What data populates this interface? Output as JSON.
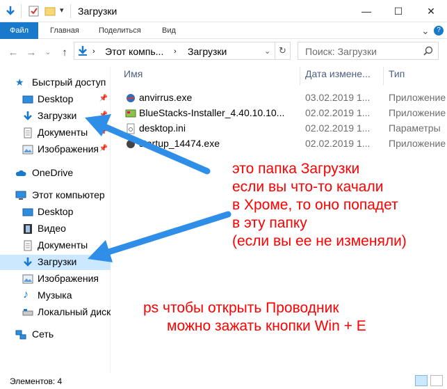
{
  "window": {
    "title": "Загрузки",
    "minimize": "—",
    "maximize": "☐",
    "close": "✕"
  },
  "ribbon": {
    "tabs": [
      "Файл",
      "Главная",
      "Поделиться",
      "Вид"
    ],
    "expand": "⌄",
    "help": "?"
  },
  "address": {
    "segments": [
      "Этот компь...",
      "Загрузки"
    ],
    "search_placeholder": "Поиск: Загрузки"
  },
  "sidebar": {
    "quick_access": "Быстрый доступ",
    "quick_items": [
      "Desktop",
      "Загрузки",
      "Документы",
      "Изображения"
    ],
    "onedrive": "OneDrive",
    "this_pc": "Этот компьютер",
    "pc_items": [
      "Desktop",
      "Видео",
      "Документы",
      "Загрузки",
      "Изображения",
      "Музыка",
      "Локальный диск"
    ],
    "network": "Сеть"
  },
  "columns": {
    "name": "Имя",
    "date": "Дата измене...",
    "type": "Тип"
  },
  "files": [
    {
      "name": "anvirrus.exe",
      "date": "03.02.2019 1...",
      "type": "Приложение"
    },
    {
      "name": "BlueStacks-Installer_4.40.10.10...",
      "date": "02.02.2019 1...",
      "type": "Приложение"
    },
    {
      "name": "desktop.ini",
      "date": "02.02.2019 1...",
      "type": "Параметры"
    },
    {
      "name": "startup_14474.exe",
      "date": "02.02.2019 1...",
      "type": "Приложение"
    }
  ],
  "status": {
    "count": "Элементов: 4"
  },
  "annotations": {
    "line1": "это папка Загрузки",
    "line2": "если вы что-то качали",
    "line3": "в Хроме, то оно попадет",
    "line4": "в эту папку",
    "line5": "(если вы ее не изменяли)",
    "tip1": "ps чтобы открыть Проводник",
    "tip2": "можно зажать кнопки Win + E"
  },
  "colors": {
    "accent": "#1979ca",
    "annotation": "#ff0000",
    "arrow": "#2f8fe8",
    "selected": "#cce8ff"
  }
}
